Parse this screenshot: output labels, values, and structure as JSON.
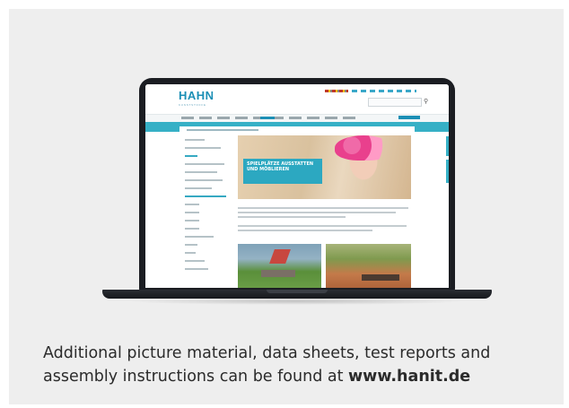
{
  "website": {
    "logo": "HAHN",
    "logo_sub": "KUNSTSTOFFE",
    "hero_title": "SPIELPLÄTZE AUSSTATTEN UND MÖBLIEREN"
  },
  "caption": {
    "line1": "Additional picture material, data sheets, test reports and",
    "line2_prefix": "assembly instructions can be found at ",
    "url": "www.hanit.de"
  },
  "colors": {
    "accent": "#36b0c6",
    "brand": "#1c8fb5",
    "card_background": "#eeeeee"
  }
}
